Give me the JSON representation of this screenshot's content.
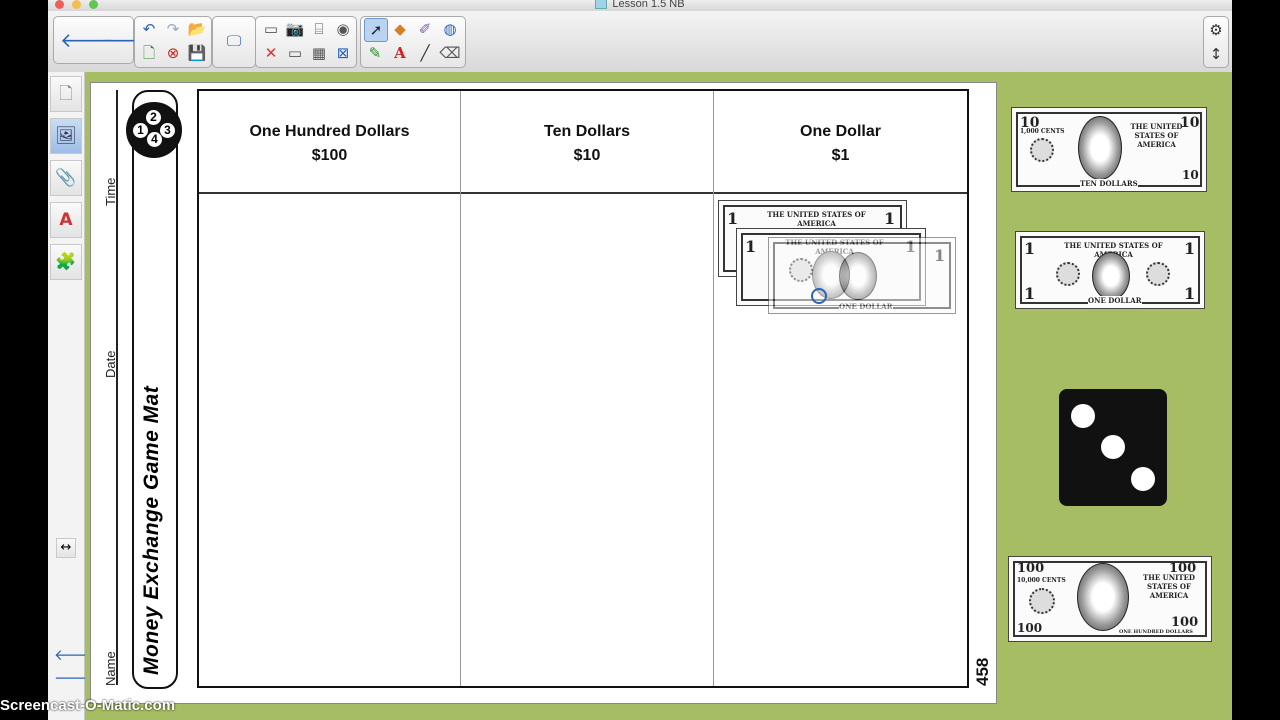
{
  "window": {
    "title": "Lesson 1.5 NB"
  },
  "toolbar": {
    "back": "🡐",
    "forward": "🡒",
    "undo": "↶",
    "redo": "↷",
    "open": "📂",
    "new_page": "🗋",
    "delete_page": "⊗",
    "save": "💾",
    "screen_shade": "▭",
    "capture": "📷",
    "document_camera": "⌸",
    "display": "🖵",
    "delete": "✕",
    "table": "▦",
    "text": "A",
    "close_box": "⊠",
    "select": "➚",
    "shapes": "◆",
    "magic_pen": "✐",
    "fill": "◍",
    "pen": "✎",
    "line": "╱",
    "eraser": "⌫",
    "settings": "⚙",
    "move_toolbar": "↕"
  },
  "sidebar": {
    "tabs": [
      {
        "name": "page-sorter-tab",
        "icon": "🗋"
      },
      {
        "name": "gallery-tab",
        "icon": "🖼"
      },
      {
        "name": "attachments-tab",
        "icon": "📎"
      },
      {
        "name": "properties-tab",
        "icon": "A"
      },
      {
        "name": "addons-tab",
        "icon": "🧩"
      }
    ],
    "resize_icon": "↔",
    "page_prev": "🡐",
    "page_next": "🡒"
  },
  "mat": {
    "title": "Money Exchange Game Mat",
    "labels": {
      "name": "Name",
      "date": "Date",
      "time": "Time"
    },
    "logo_numbers": [
      "1",
      "2",
      "4",
      "3"
    ],
    "page_number": "458",
    "columns": [
      {
        "title": "One Hundred Dollars",
        "value": "$100"
      },
      {
        "title": "Ten Dollars",
        "value": "$10"
      },
      {
        "title": "One Dollar",
        "value": "$1"
      }
    ]
  },
  "bills": {
    "ten": {
      "corner": "10",
      "top": "THE UNITED STATES OF AMERICA",
      "cents": "1,000 CENTS",
      "bottom": "TEN DOLLARS"
    },
    "one": {
      "corner": "1",
      "top": "THE UNITED STATES OF AMERICA",
      "cents": "100 CENTS",
      "bottom": "ONE DOLLAR"
    },
    "hundred": {
      "corner": "100",
      "top": "THE UNITED STATES OF AMERICA",
      "cents": "10,000 CENTS",
      "bottom": "ONE HUNDRED DOLLARS"
    }
  },
  "die": {
    "value": 3
  },
  "watermark": "Screencast-O-Matic.com",
  "colors": {
    "canvas": "#a6bd63",
    "accent": "#2a63b8"
  }
}
